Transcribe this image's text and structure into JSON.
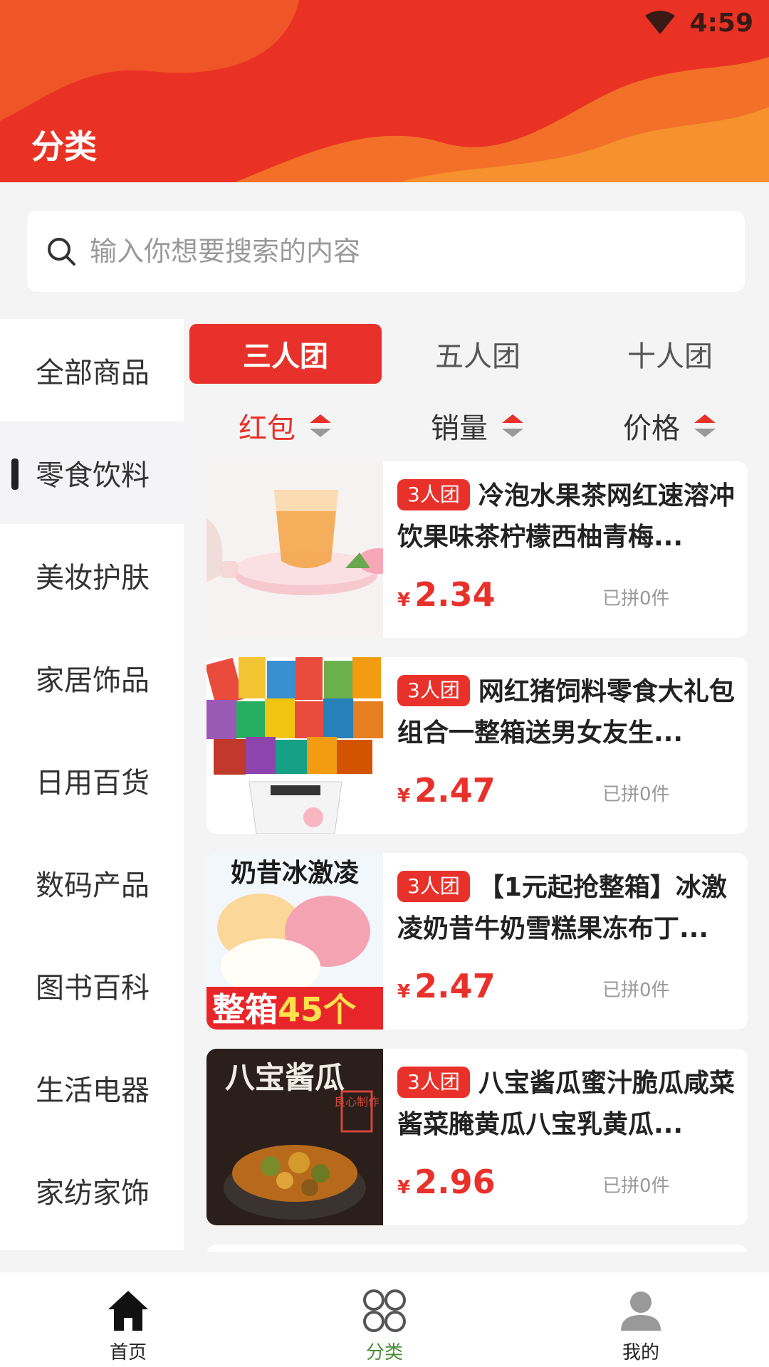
{
  "status": {
    "time": "4:59"
  },
  "header": {
    "title": "分类"
  },
  "search": {
    "placeholder": "输入你想要搜索的内容"
  },
  "sidebar": {
    "items": [
      {
        "label": "全部商品"
      },
      {
        "label": "零食饮料",
        "active": true
      },
      {
        "label": "美妆护肤"
      },
      {
        "label": "家居饰品"
      },
      {
        "label": "日用百货"
      },
      {
        "label": "数码产品"
      },
      {
        "label": "图书百科"
      },
      {
        "label": "生活电器"
      },
      {
        "label": "家纺家饰"
      }
    ]
  },
  "group_tabs": [
    {
      "label": "三人团",
      "active": true
    },
    {
      "label": "五人团"
    },
    {
      "label": "十人团"
    }
  ],
  "sort": [
    {
      "label": "红包",
      "active": true
    },
    {
      "label": "销量"
    },
    {
      "label": "价格"
    }
  ],
  "products": [
    {
      "badge": "3人团",
      "name": "冷泡水果茶网红速溶冲饮果味茶柠檬西柚青梅...",
      "currency": "¥",
      "price": "2.34",
      "sold": "已拼0件"
    },
    {
      "badge": "3人团",
      "name": "网红猪饲料零食大礼包组合一整箱送男女友生...",
      "currency": "¥",
      "price": "2.47",
      "sold": "已拼0件"
    },
    {
      "badge": "3人团",
      "name": "【1元起抢整箱】冰激凌奶昔牛奶雪糕果冻布丁...",
      "currency": "¥",
      "price": "2.47",
      "sold": "已拼0件",
      "image_text": [
        "奶昔冰激凌",
        "整箱",
        "45个"
      ]
    },
    {
      "badge": "3人团",
      "name": "八宝酱瓜蜜汁脆瓜咸菜酱菜腌黄瓜八宝乳黄瓜...",
      "currency": "¥",
      "price": "2.96",
      "sold": "已拼0件",
      "image_text": [
        "八宝酱瓜",
        "良心制作"
      ]
    }
  ],
  "bottom_nav": [
    {
      "label": "首页",
      "icon": "home-icon"
    },
    {
      "label": "分类",
      "icon": "category-icon",
      "active": true
    },
    {
      "label": "我的",
      "icon": "profile-icon"
    }
  ],
  "colors": {
    "brand_red": "#e8312a",
    "header_red": "#ea3224",
    "active_nav": "#4a8c3a"
  }
}
